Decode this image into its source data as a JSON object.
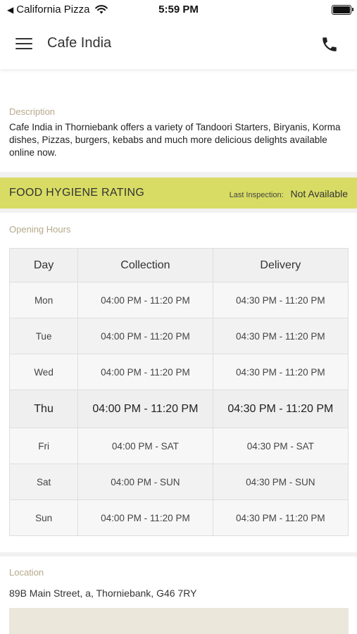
{
  "status_bar": {
    "back_app": "California Pizza",
    "time": "5:59 PM"
  },
  "header": {
    "title": "Cafe India"
  },
  "description": {
    "label": "Description",
    "text": "Cafe India in Thorniebank offers a variety of Tandoori Starters, Biryanis, Korma dishes, Pizzas, burgers, kebabs and much more delicious delights available online now."
  },
  "hygiene": {
    "title": "FOOD HYGIENE RATING",
    "inspection_label": "Last Inspection:",
    "inspection_value": "Not Available",
    "bar_color": "#d8dc64"
  },
  "opening_hours": {
    "label": "Opening Hours",
    "headers": [
      "Day",
      "Collection",
      "Delivery"
    ],
    "rows": [
      {
        "day": "Mon",
        "collection": "04:00 PM - 11:20 PM",
        "delivery": "04:30 PM - 11:20 PM"
      },
      {
        "day": "Tue",
        "collection": "04:00 PM - 11:20 PM",
        "delivery": "04:30 PM - 11:20 PM"
      },
      {
        "day": "Wed",
        "collection": "04:00 PM - 11:20 PM",
        "delivery": "04:30 PM - 11:20 PM"
      },
      {
        "day": "Thu",
        "collection": "04:00 PM - 11:20 PM",
        "delivery": "04:30 PM - 11:20 PM"
      },
      {
        "day": "Fri",
        "collection": "04:00 PM - SAT",
        "delivery": "04:30 PM - SAT"
      },
      {
        "day": "Sat",
        "collection": "04:00 PM - SUN",
        "delivery": "04:30 PM - SUN"
      },
      {
        "day": "Sun",
        "collection": "04:00 PM - 11:20 PM",
        "delivery": "04:30 PM - 11:20 PM"
      }
    ]
  },
  "location": {
    "label": "Location",
    "address": "89B Main Street, a, Thorniebank, G46 7RY"
  },
  "icons": {
    "menu": "hamburger-menu-icon",
    "call": "phone-icon",
    "wifi": "wifi-icon",
    "battery": "battery-icon"
  }
}
